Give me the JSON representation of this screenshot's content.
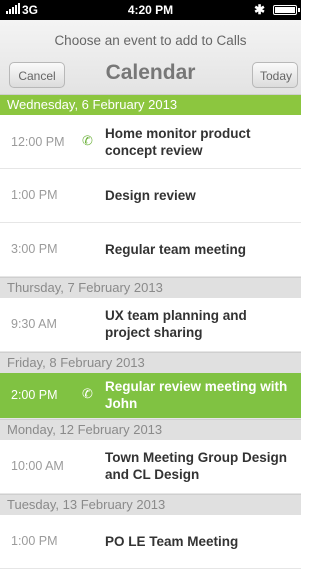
{
  "status": {
    "network": "3G",
    "time": "4:20 PM"
  },
  "header": {
    "prompt": "Choose an event to add to Calls",
    "title": "Calendar",
    "cancel_label": "Cancel",
    "today_label": "Today"
  },
  "sections": [
    {
      "date": "Wednesday, 6 February 2013",
      "events": [
        {
          "time": "12:00 PM",
          "title": "Home monitor product concept review",
          "call": true
        },
        {
          "time": "1:00 PM",
          "title": "Design review"
        },
        {
          "time": "3:00 PM",
          "title": "Regular team meeting"
        }
      ]
    },
    {
      "date": "Thursday, 7 February 2013",
      "events": [
        {
          "time": "9:30 AM",
          "title": "UX team planning and project sharing"
        }
      ]
    },
    {
      "date": "Friday, 8 February 2013",
      "events": [
        {
          "time": "2:00 PM",
          "title": "Regular review meeting with John",
          "call": true,
          "selected": true
        }
      ]
    },
    {
      "date": "Monday, 12 February 2013",
      "events": [
        {
          "time": "10:00 AM",
          "title": "Town Meeting Group Design and CL Design"
        }
      ]
    },
    {
      "date": "Tuesday, 13 February 2013",
      "events": [
        {
          "time": "1:00 PM",
          "title": "PO LE Team Meeting"
        }
      ]
    }
  ]
}
